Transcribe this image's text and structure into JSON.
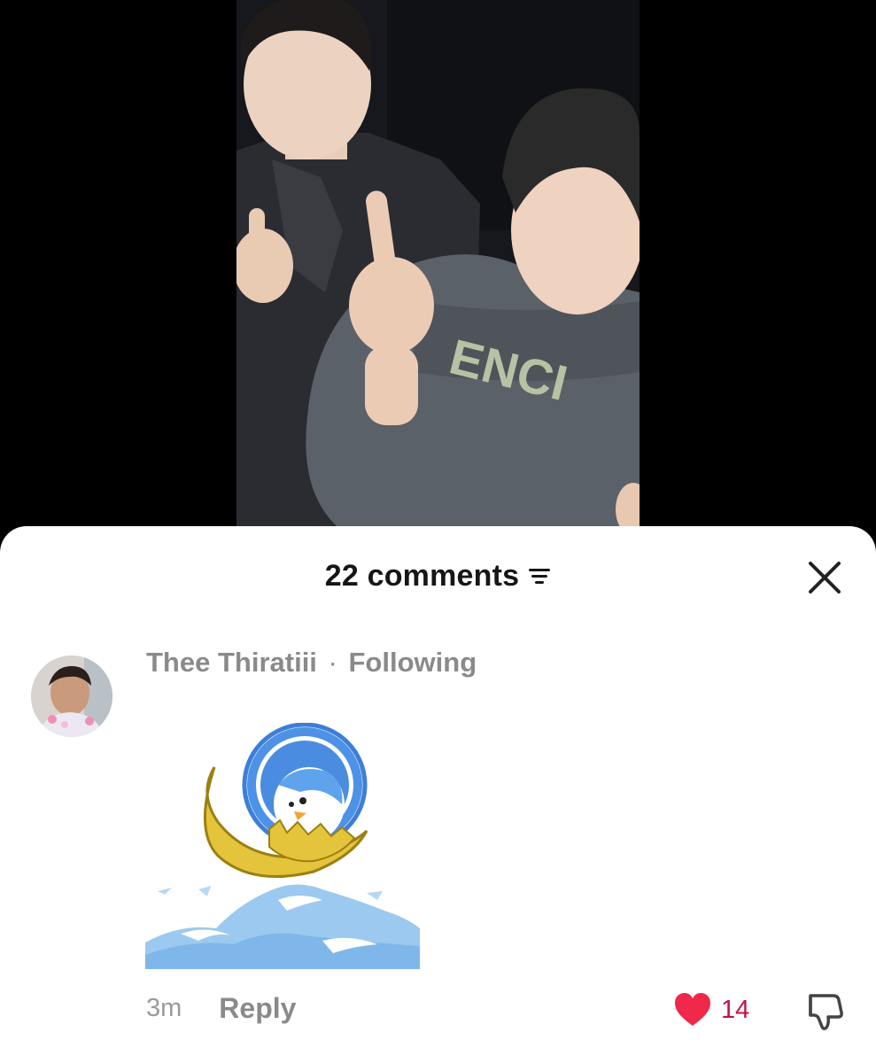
{
  "sheet": {
    "title": "22 comments"
  },
  "comment": {
    "username": "Thee Thiratiii",
    "separator": "·",
    "relation": "Following",
    "time": "3m",
    "reply_label": "Reply",
    "like_count": "14"
  },
  "colors": {
    "like_heart": "#f0284a",
    "like_count": "#c01444",
    "sheet_bg": "#ffffff",
    "muted_text": "#8a8a8a"
  },
  "icons": {
    "sort": "sort-lines-icon",
    "close": "close-x-icon",
    "like": "heart-filled-icon",
    "dislike": "thumbs-down-icon"
  }
}
